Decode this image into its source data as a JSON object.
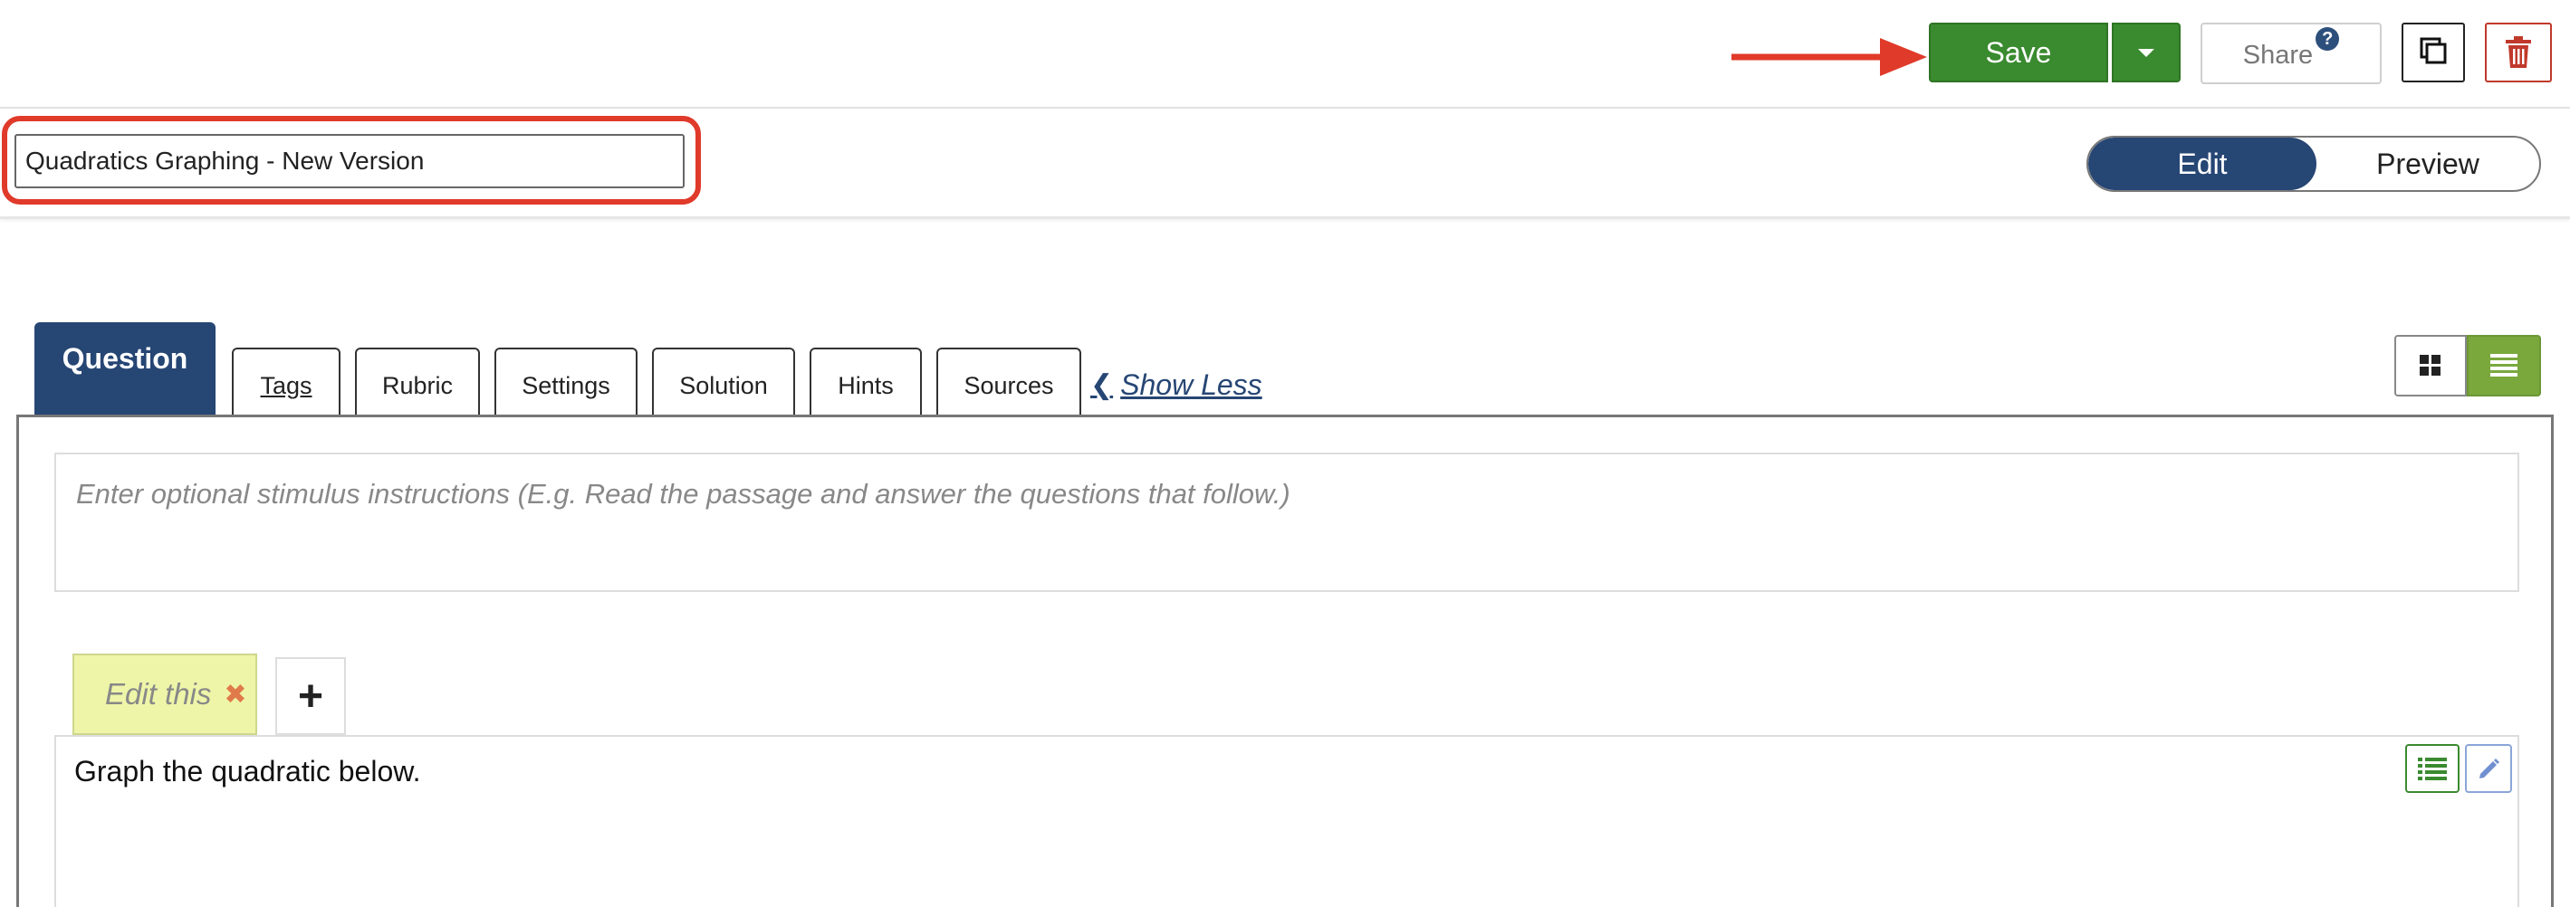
{
  "toolbar": {
    "save_label": "Save",
    "share_label": "Share",
    "share_help": "?"
  },
  "title_input": {
    "value": "Quadratics Graphing - New Version"
  },
  "mode_toggle": {
    "edit_label": "Edit",
    "preview_label": "Preview",
    "active": "Edit"
  },
  "tabs": {
    "active": "Question",
    "items": [
      "Question",
      "Tags",
      "Rubric",
      "Settings",
      "Solution",
      "Hints",
      "Sources"
    ],
    "show_less_label": "Show Less"
  },
  "editor": {
    "stimulus_placeholder": "Enter optional stimulus instructions (E.g. Read the passage and answer the questions that follow.)",
    "chip_label": "Edit this",
    "add_label": "+",
    "question_text": "Graph the quadratic below."
  },
  "colors": {
    "save_green": "#3a8a2f",
    "navy": "#264674",
    "highlight_red": "#e03a2a",
    "list_view_green": "#7aa83d",
    "chip_yellow": "#eef5a8"
  },
  "icons": {
    "save_dropdown": "caret-down-icon",
    "share_help": "question-circle-icon",
    "duplicate": "copy-icon",
    "delete": "trash-icon",
    "grid_view": "grid-icon",
    "list_view": "list-icon",
    "chip_remove": "close-icon",
    "question_list": "list-icon",
    "question_edit": "pencil-icon",
    "annotation": "arrow-icon"
  }
}
